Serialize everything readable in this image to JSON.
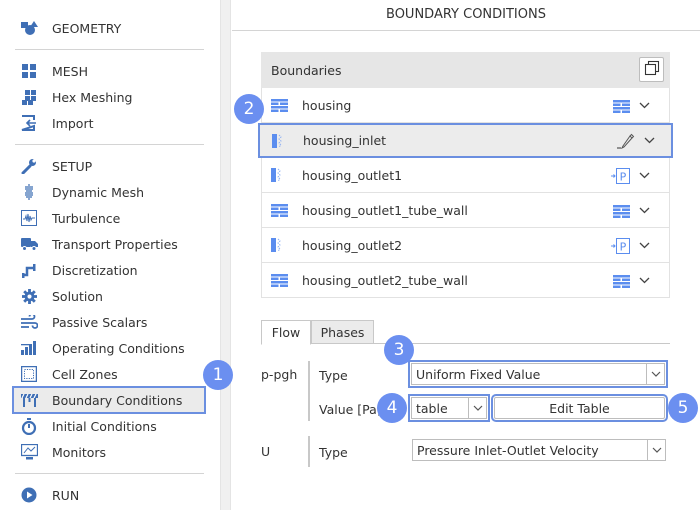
{
  "sidebar": {
    "geometry": {
      "label": "GEOMETRY",
      "icon": "shapes-icon"
    },
    "mesh_group": [
      {
        "label": "MESH",
        "icon": "grid-icon"
      },
      {
        "label": "Hex Meshing",
        "icon": "hex-mesh-icon"
      },
      {
        "label": "Import",
        "icon": "import-icon"
      }
    ],
    "setup_group": [
      {
        "label": "SETUP",
        "icon": "wrench-icon"
      },
      {
        "label": "Dynamic Mesh",
        "icon": "spring-icon"
      },
      {
        "label": "Turbulence",
        "icon": "waveform-icon"
      },
      {
        "label": "Transport Properties",
        "icon": "truck-icon"
      },
      {
        "label": "Discretization",
        "icon": "pipe-icon"
      },
      {
        "label": "Solution",
        "icon": "gear-icon"
      },
      {
        "label": "Passive Scalars",
        "icon": "wind-icon"
      },
      {
        "label": "Operating Conditions",
        "icon": "bars-icon"
      },
      {
        "label": "Cell Zones",
        "icon": "cell-zone-icon"
      },
      {
        "label": "Boundary Conditions",
        "icon": "barrier-icon",
        "selected": true
      },
      {
        "label": "Initial Conditions",
        "icon": "stopwatch-icon"
      },
      {
        "label": "Monitors",
        "icon": "monitor-icon"
      }
    ],
    "run": {
      "label": "RUN",
      "icon": "play-icon"
    }
  },
  "main": {
    "title": "BOUNDARY CONDITIONS",
    "boundaries_header": "Boundaries",
    "boundaries": [
      {
        "name": "housing",
        "kind": "wall",
        "type_icon": "wall"
      },
      {
        "name": "housing_inlet",
        "kind": "patch",
        "type_icon": "edit",
        "selected": true
      },
      {
        "name": "housing_outlet1",
        "kind": "patch",
        "type_icon": "pressure"
      },
      {
        "name": "housing_outlet1_tube_wall",
        "kind": "wall",
        "type_icon": "wall"
      },
      {
        "name": "housing_outlet2",
        "kind": "patch",
        "type_icon": "pressure"
      },
      {
        "name": "housing_outlet2_tube_wall",
        "kind": "wall",
        "type_icon": "wall"
      }
    ],
    "tabs": [
      {
        "label": "Flow",
        "active": true
      },
      {
        "label": "Phases",
        "active": false
      }
    ],
    "p_pgh": {
      "label": "p-pgh",
      "type_label": "Type",
      "type_value": "Uniform Fixed Value",
      "value_label": "Value [Pa]",
      "value_select": "table",
      "edit_button": "Edit Table"
    },
    "u": {
      "label": "U",
      "type_label": "Type",
      "type_value": "Pressure Inlet-Outlet Velocity"
    }
  },
  "badges": [
    "1",
    "2",
    "3",
    "4",
    "5"
  ],
  "colors": {
    "accent": "#6b8fe0",
    "icon_blue": "#3f6fb5",
    "badge": "#6b8ff0"
  }
}
